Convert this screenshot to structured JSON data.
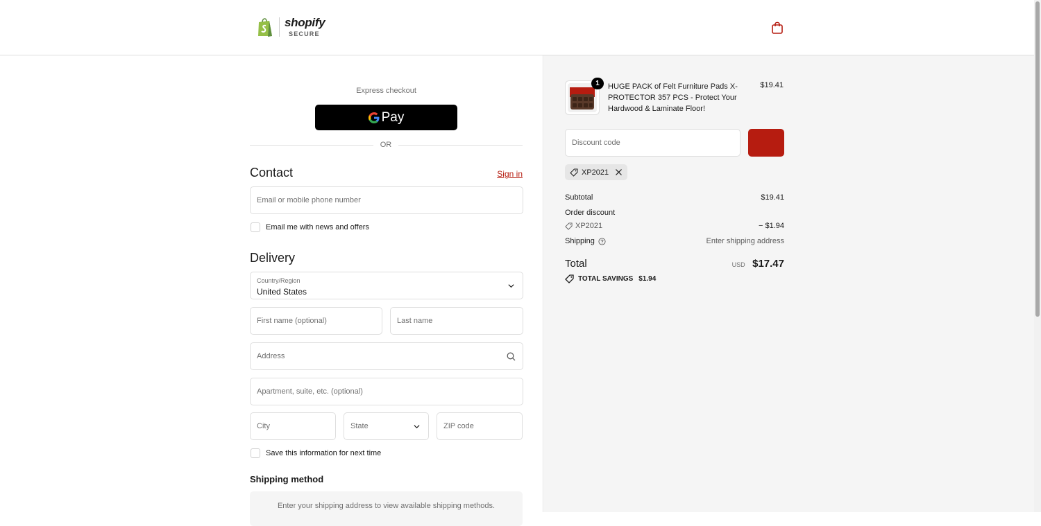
{
  "header": {
    "brand": "shopify",
    "badge": "SECURE"
  },
  "express": {
    "label": "Express checkout",
    "gpay_label": "Pay",
    "or": "OR"
  },
  "contact": {
    "title": "Contact",
    "signin": "Sign in",
    "email_placeholder": "Email or mobile phone number",
    "newsletter_label": "Email me with news and offers"
  },
  "delivery": {
    "title": "Delivery",
    "country_label": "Country/Region",
    "country_value": "United States",
    "first_name_placeholder": "First name (optional)",
    "last_name_placeholder": "Last name",
    "address_placeholder": "Address",
    "apartment_placeholder": "Apartment, suite, etc. (optional)",
    "city_placeholder": "City",
    "state_placeholder": "State",
    "zip_placeholder": "ZIP code",
    "save_info_label": "Save this information for next time"
  },
  "shipping_method": {
    "title": "Shipping method",
    "message": "Enter your shipping address to view available shipping methods."
  },
  "summary": {
    "product": {
      "name": "HUGE PACK of Felt Furniture Pads X-PROTECTOR 357 PCS - Protect Your Hardwood & Laminate Floor!",
      "price": "$19.41",
      "quantity": "1"
    },
    "discount_placeholder": "Discount code",
    "applied_code": "XP2021",
    "subtotal_label": "Subtotal",
    "subtotal_value": "$19.41",
    "order_discount_label": "Order discount",
    "discount_code": "XP2021",
    "discount_value": "− $1.94",
    "shipping_label": "Shipping",
    "shipping_value": "Enter shipping address",
    "total_label": "Total",
    "currency": "USD",
    "total_value": "$17.47",
    "savings_label": "TOTAL SAVINGS",
    "savings_value": "$1.94"
  },
  "colors": {
    "accent": "#b61c10",
    "shopify_green": "#95bf47"
  }
}
